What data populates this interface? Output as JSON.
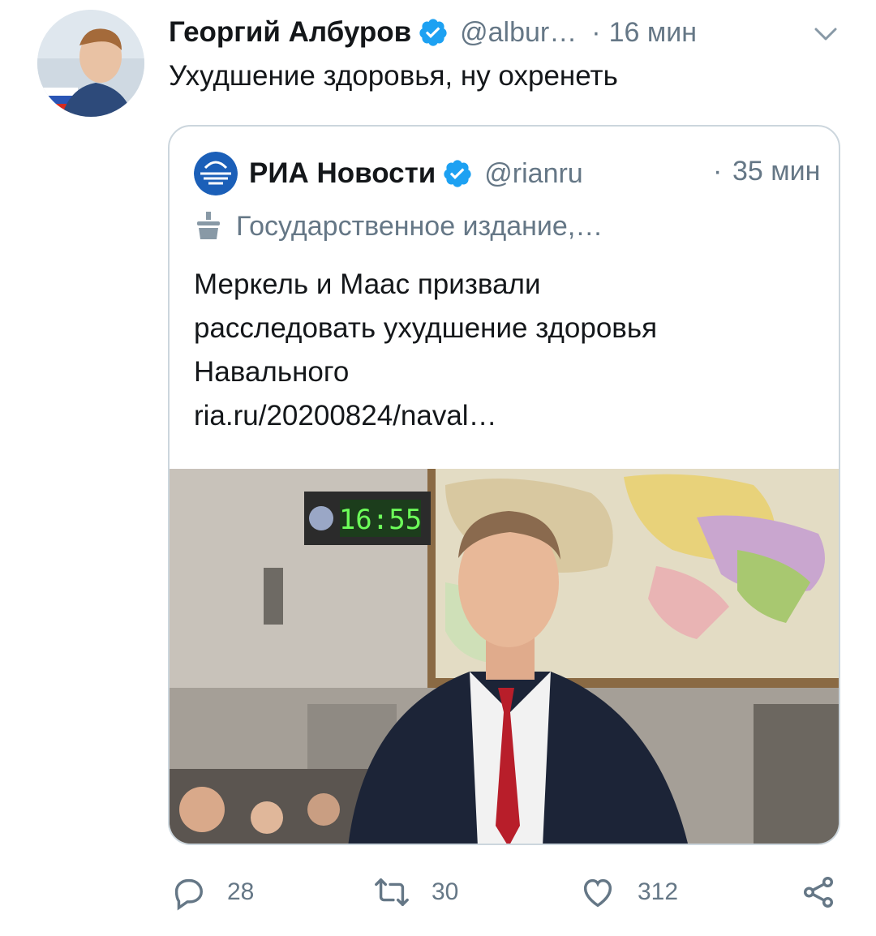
{
  "tweet": {
    "author_name": "Георгий Албуров",
    "handle": "@albur…",
    "separator": "·",
    "time": "16 мин",
    "text": "Ухудшение здоровья, ну охренеть",
    "verified_icon": "verified-badge-icon",
    "menu_icon": "chevron-down-icon"
  },
  "quote": {
    "name": "РИА Новости",
    "handle": "@rianru",
    "separator": "·",
    "time": "35 мин",
    "label": "Государственное издание,…",
    "text_lines": [
      "Меркель и Маас призвали",
      "расследовать ухудшение здоровья",
      "Навального"
    ],
    "link": "ria.ru/20200824/naval…",
    "clock_display": "16:55"
  },
  "actions": {
    "reply_count": "28",
    "retweet_count": "30",
    "like_count": "312",
    "reply_icon": "reply-icon",
    "retweet_icon": "retweet-icon",
    "like_icon": "heart-icon",
    "share_icon": "share-icon"
  },
  "colors": {
    "verified": "#1da1f2",
    "secondary_text": "#657786",
    "border": "#ccd6dd",
    "text": "#14171a"
  }
}
